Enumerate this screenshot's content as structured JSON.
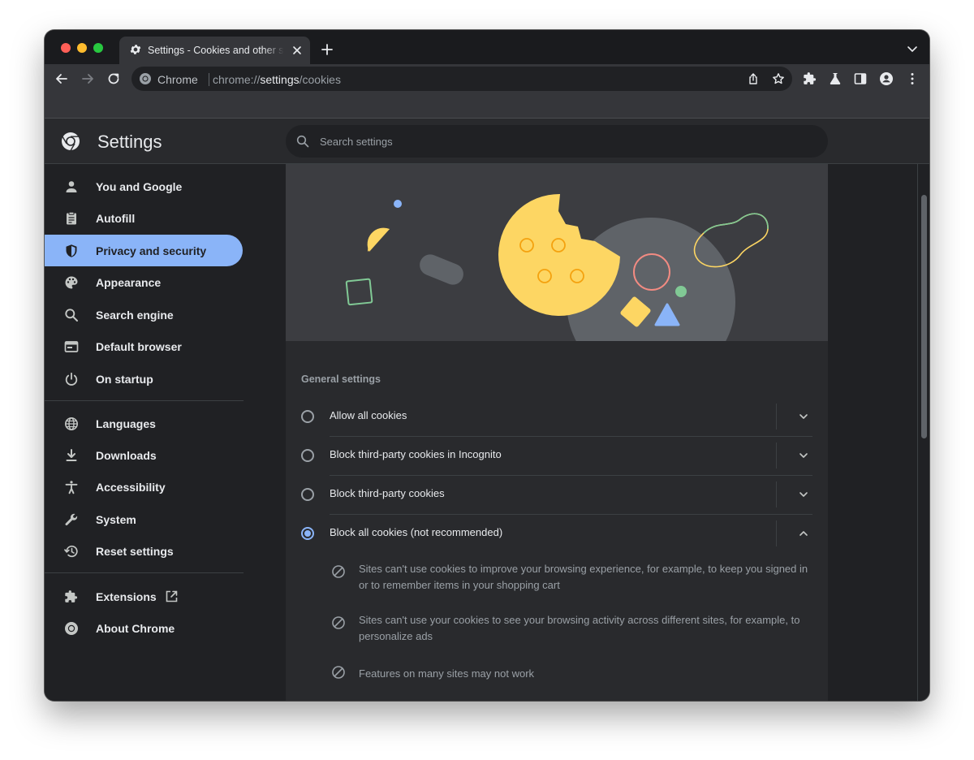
{
  "browser": {
    "tab_title": "Settings - Cookies and other site data",
    "omnibox_chip": "Chrome",
    "url_scheme": "chrome://",
    "url_host": "settings",
    "url_path": "/cookies"
  },
  "header": {
    "title": "Settings",
    "search_placeholder": "Search settings"
  },
  "sidebar": {
    "items": [
      {
        "label": "You and Google",
        "icon": "person-icon"
      },
      {
        "label": "Autofill",
        "icon": "clipboard-icon"
      },
      {
        "label": "Privacy and security",
        "icon": "shield-icon",
        "active": true
      },
      {
        "label": "Appearance",
        "icon": "palette-icon"
      },
      {
        "label": "Search engine",
        "icon": "search-icon"
      },
      {
        "label": "Default browser",
        "icon": "browser-icon"
      },
      {
        "label": "On startup",
        "icon": "power-icon"
      },
      {
        "label": "Languages",
        "icon": "globe-icon"
      },
      {
        "label": "Downloads",
        "icon": "download-icon"
      },
      {
        "label": "Accessibility",
        "icon": "accessibility-icon"
      },
      {
        "label": "System",
        "icon": "wrench-icon"
      },
      {
        "label": "Reset settings",
        "icon": "history-icon"
      },
      {
        "label": "Extensions",
        "icon": "puzzle-icon"
      },
      {
        "label": "About Chrome",
        "icon": "chrome-icon"
      }
    ]
  },
  "general": {
    "section_title": "General settings",
    "options": [
      {
        "label": "Allow all cookies",
        "selected": false,
        "expanded": false
      },
      {
        "label": "Block third-party cookies in Incognito",
        "selected": false,
        "expanded": false
      },
      {
        "label": "Block third-party cookies",
        "selected": false,
        "expanded": false
      },
      {
        "label": "Block all cookies (not recommended)",
        "selected": true,
        "expanded": true
      }
    ],
    "details": [
      "Sites can't use cookies to improve your browsing experience, for example, to keep you signed in or to remember items in your shopping cart",
      "Sites can't use your cookies to see your browsing activity across different sites, for example, to personalize ads",
      "Features on many sites may not work"
    ]
  },
  "colors": {
    "accent": "#8ab4f8",
    "background": "#202124",
    "surface": "#292a2d",
    "text": "#e8eaed",
    "muted_text": "#9aa0a6"
  }
}
